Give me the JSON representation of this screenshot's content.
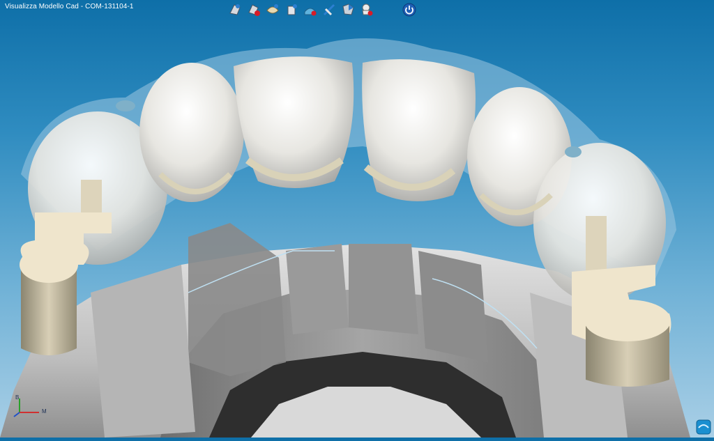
{
  "window": {
    "title": "Visualizza Modello Cad  - COM-131104-1"
  },
  "toolbar": {
    "buttons": [
      {
        "id": "view-model",
        "icon": "model-view-icon"
      },
      {
        "id": "toggle-model",
        "icon": "model-hide-icon"
      },
      {
        "id": "view-crowns",
        "icon": "crown-view-icon"
      },
      {
        "id": "view-abutment",
        "icon": "abutment-view-icon"
      },
      {
        "id": "view-gingiva",
        "icon": "gingiva-view-icon"
      },
      {
        "id": "view-section",
        "icon": "section-view-icon"
      },
      {
        "id": "view-shaded",
        "icon": "shaded-view-icon"
      },
      {
        "id": "view-antagonist",
        "icon": "antagonist-view-icon"
      }
    ],
    "power_icon": "power-icon"
  },
  "axis": {
    "label_x": "M",
    "label_y": "B"
  },
  "colors": {
    "background_top": "#0e6fa8",
    "background_bottom": "#a9cfe6",
    "tooth": "#e9e8e2",
    "model": "#c9c9c9",
    "gingiva_overlay": "#9cc6e0",
    "abutment": "#efe5cc"
  }
}
